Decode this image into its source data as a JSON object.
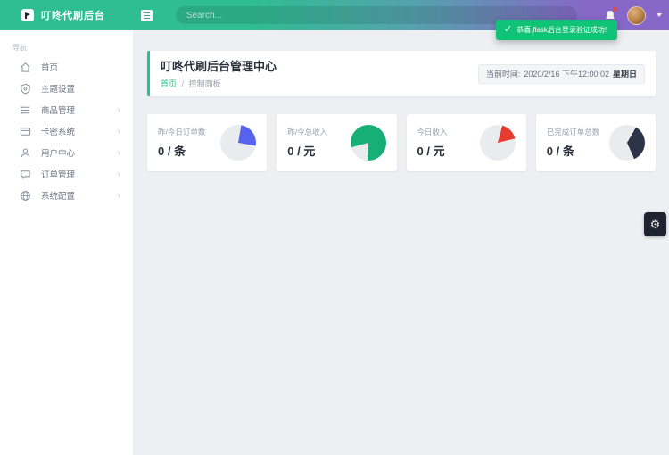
{
  "navbar": {
    "brand": "叮咚代刷后台",
    "search_placeholder": "Search..."
  },
  "toast": {
    "check": "✓",
    "message": "恭喜,flask后台登录验证成功!"
  },
  "sidebar": {
    "section_label": "导航",
    "submenu_arrow": "›",
    "items": [
      {
        "label": "首页",
        "icon": "home-icon",
        "has_submenu": false
      },
      {
        "label": "主题设置",
        "icon": "shield-icon",
        "has_submenu": false
      },
      {
        "label": "商品管理",
        "icon": "list-icon",
        "has_submenu": true
      },
      {
        "label": "卡密系统",
        "icon": "card-icon",
        "has_submenu": true
      },
      {
        "label": "用户中心",
        "icon": "user-icon",
        "has_submenu": true
      },
      {
        "label": "订单管理",
        "icon": "chat-icon",
        "has_submenu": true
      },
      {
        "label": "系统配置",
        "icon": "globe-icon",
        "has_submenu": true
      }
    ]
  },
  "page_header": {
    "title": "叮咚代刷后台管理中心",
    "breadcrumb": {
      "home": "首页",
      "separator": "/",
      "current": "控制面板"
    },
    "clock": {
      "label": "当前时间:",
      "datetime": "2020/2/16 下午12:00:02",
      "weekday": "星期日"
    }
  },
  "stats": [
    {
      "label": "昨/今日订单数",
      "value": "0 / 条",
      "pie": {
        "type": "pie",
        "percent": 25,
        "rotate_deg": 10,
        "color": "#5663ef",
        "track": "#e9ebef"
      }
    },
    {
      "label": "昨/今总收入",
      "value": "0 / 元",
      "pie": {
        "type": "pie",
        "percent": 80,
        "rotate_deg": 255,
        "color": "#16b077",
        "track": "#e9ebef"
      }
    },
    {
      "label": "今日收入",
      "value": "0 / 元",
      "pie": {
        "type": "pie",
        "percent": 17,
        "rotate_deg": 15,
        "color": "#e73b30",
        "track": "#e9ebef"
      }
    },
    {
      "label": "已完成订单总数",
      "value": "0 / 条",
      "pie": {
        "type": "pie",
        "percent": 35,
        "rotate_deg": 30,
        "color": "#2e3448",
        "track": "#e9ebef"
      }
    }
  ],
  "fab": {
    "gear_glyph": "⚙"
  },
  "colors": {
    "navbar_green": "#2fbd92",
    "navbar_purple": "#8767c8",
    "toast_green": "#10c377",
    "accent_green": "#26c487",
    "content_bg": "#edeff3"
  }
}
